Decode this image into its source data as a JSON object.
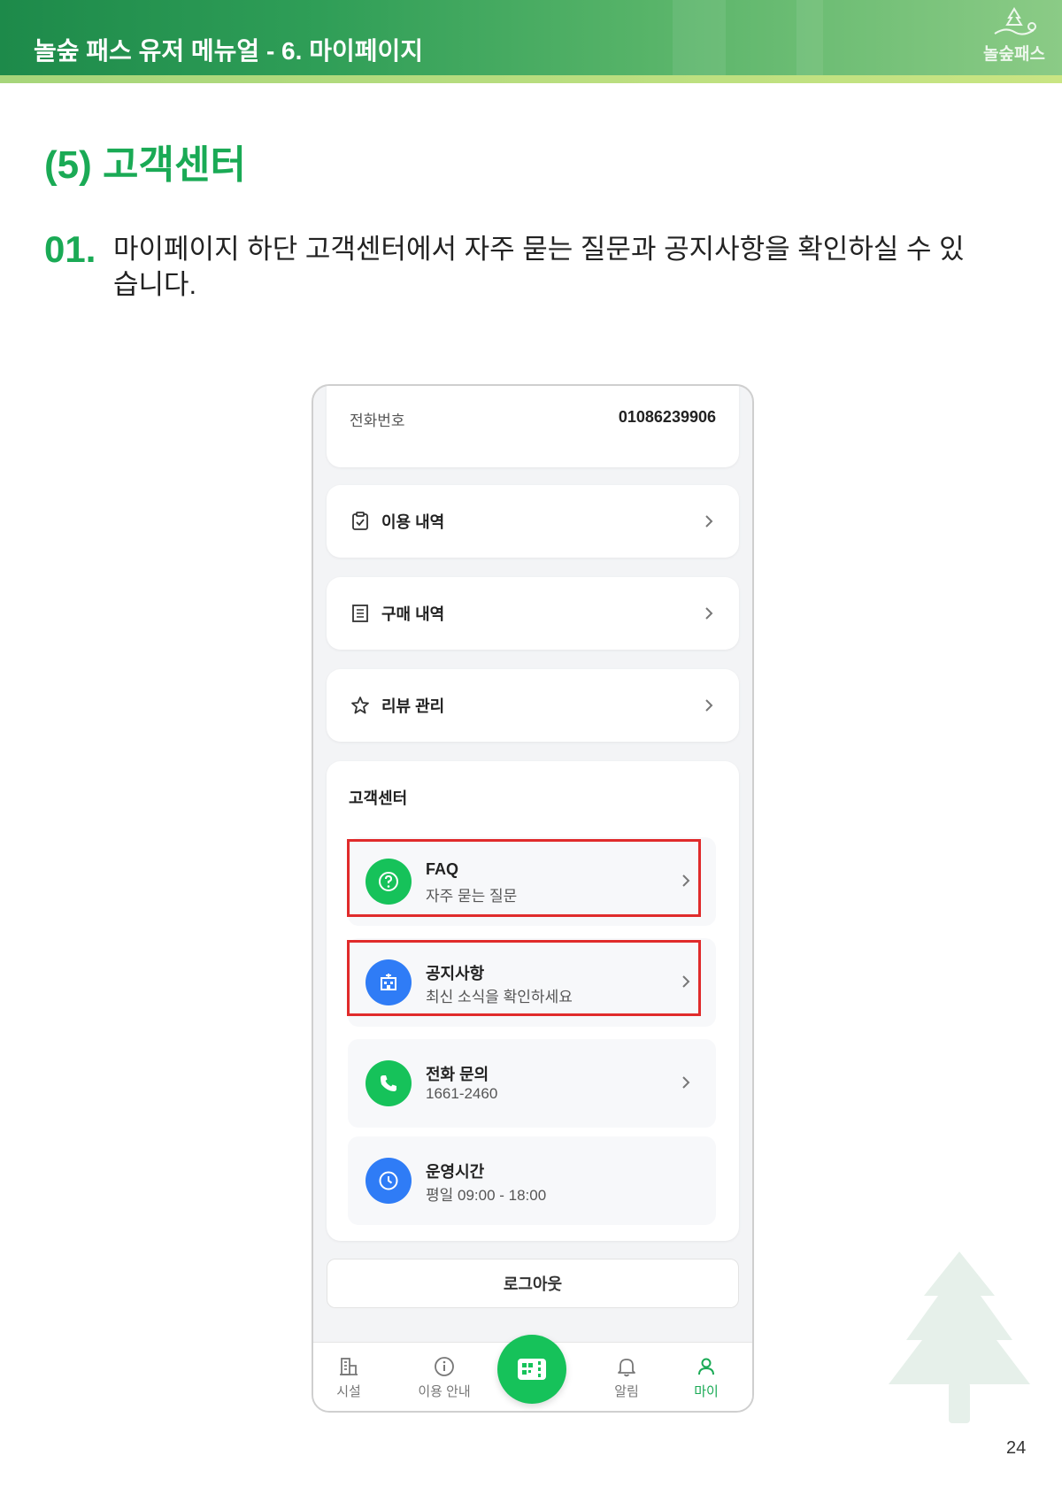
{
  "header": {
    "title": "놀숲 패스 유저 메뉴얼 - 6. 마이페이지",
    "logo_text": "놀숲패스"
  },
  "section_title": "(5) 고객센터",
  "step": {
    "number": "01.",
    "text": "마이페이지 하단 고객센터에서 자주 묻는 질문과 공지사항을 확인하실 수 있습니다."
  },
  "phone": {
    "phone_row": {
      "label": "전화번호",
      "value": "01086239906"
    },
    "menu": [
      {
        "label": "이용 내역",
        "icon": "clipboard-check-icon"
      },
      {
        "label": "구매 내역",
        "icon": "receipt-icon"
      },
      {
        "label": "리뷰 관리",
        "icon": "star-icon"
      }
    ],
    "customer_center": {
      "title": "고객센터",
      "items": [
        {
          "title": "FAQ",
          "subtitle": "자주 묻는 질문",
          "icon": "question-icon",
          "color": "#16c25a"
        },
        {
          "title": "공지사항",
          "subtitle": "최신 소식을 확인하세요",
          "icon": "building-icon",
          "color": "#2f7cf6"
        },
        {
          "title": "전화 문의",
          "subtitle": "1661-2460",
          "icon": "phone-icon",
          "color": "#16c25a"
        },
        {
          "title": "운영시간",
          "subtitle": "평일 09:00 - 18:00",
          "icon": "clock-icon",
          "color": "#2f7cf6"
        }
      ]
    },
    "logout_label": "로그아웃",
    "tabs": [
      {
        "label": "시설",
        "icon": "facility-icon"
      },
      {
        "label": "이용 안내",
        "icon": "info-icon"
      },
      {
        "label": "알림",
        "icon": "bell-icon"
      },
      {
        "label": "마이",
        "icon": "user-icon",
        "active": true
      }
    ],
    "center_button_icon": "ticket-qr-icon"
  },
  "colors": {
    "accent_green": "#1aaa55",
    "highlight_red": "#e02b2b",
    "blue": "#2f7cf6"
  },
  "page_number": "24"
}
